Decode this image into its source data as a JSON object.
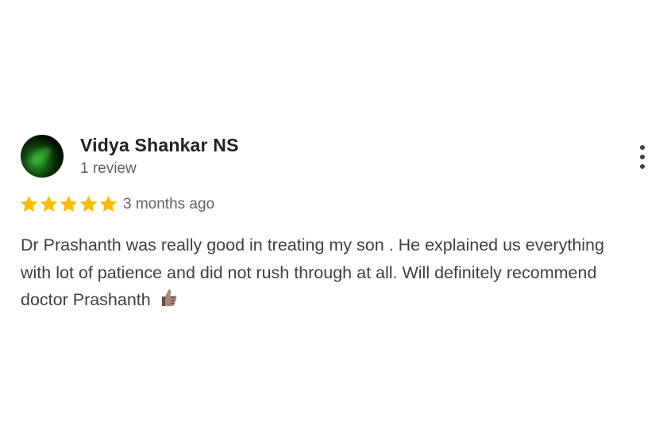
{
  "review": {
    "reviewer_name": "Vidya Shankar NS",
    "review_count": "1 review",
    "rating": 5,
    "rating_max": 5,
    "time_ago": "3 months ago",
    "text": "Dr Prashanth was really good in treating my son . He explained us everything with lot of patience and did not rush through at all. Will definitely recommend doctor Prashanth",
    "emoji": "thumbs-up-icon"
  },
  "colors": {
    "star": "#fbbc04",
    "name": "#202124",
    "secondary": "#5f6368",
    "body": "#3c4043",
    "thumb": "#8d6e63"
  },
  "icons": {
    "more": "more-vert-icon",
    "star": "star-icon",
    "avatar": "avatar-image"
  }
}
